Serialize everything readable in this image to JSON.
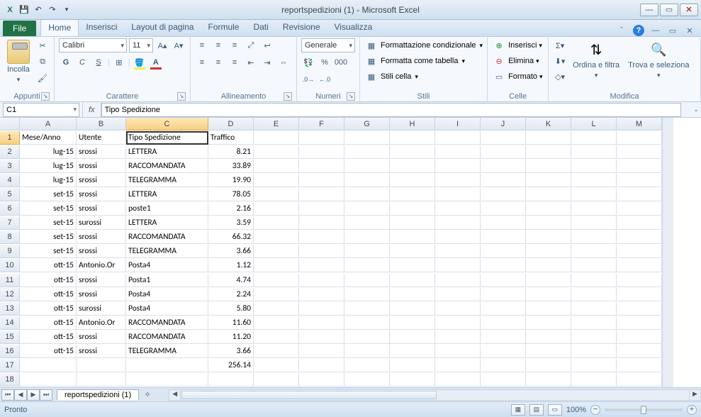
{
  "title": "reportspedizioni (1)  -  Microsoft Excel",
  "qat": {
    "save_tip": "Save",
    "undo_tip": "Undo",
    "redo_tip": "Redo"
  },
  "tabs": {
    "file": "File",
    "items": [
      "Home",
      "Inserisci",
      "Layout di pagina",
      "Formule",
      "Dati",
      "Revisione",
      "Visualizza"
    ],
    "active": 0
  },
  "ribbon": {
    "clipboard": {
      "paste": "Incolla",
      "group": "Appunti"
    },
    "font": {
      "group": "Carattere",
      "name": "Calibri",
      "size": "11",
      "bold": "G",
      "italic": "C",
      "underline": "S"
    },
    "align": {
      "group": "Allineamento"
    },
    "number": {
      "group": "Numeri",
      "format": "Generale"
    },
    "styles": {
      "group": "Stili",
      "cond": "Formattazione condizionale",
      "table": "Formatta come tabella",
      "cell": "Stili cella"
    },
    "cells": {
      "group": "Celle",
      "insert": "Inserisci",
      "delete": "Elimina",
      "format": "Formato"
    },
    "editing": {
      "group": "Modifica",
      "sort": "Ordina e filtra",
      "find": "Trova e seleziona"
    }
  },
  "formula": {
    "cellref": "C1",
    "value": "Tipo Spedizione"
  },
  "columns": [
    "A",
    "B",
    "C",
    "D",
    "E",
    "F",
    "G",
    "H",
    "I",
    "J",
    "K",
    "L",
    "M"
  ],
  "selected_col_index": 2,
  "selected_row": 1,
  "row_count": 18,
  "data_rows": [
    [
      "Mese/Anno",
      "Utente",
      "Tipo Spedizione",
      "Traffico"
    ],
    [
      "lug-15",
      "srossi",
      "LETTERA",
      "8.21"
    ],
    [
      "lug-15",
      "srossi",
      "RACCOMANDATA",
      "33.89"
    ],
    [
      "lug-15",
      "srossi",
      "TELEGRAMMA",
      "19.90"
    ],
    [
      "set-15",
      "srossi",
      "LETTERA",
      "78.05"
    ],
    [
      "set-15",
      "srossi",
      "poste1",
      "2.16"
    ],
    [
      "set-15",
      "surossi",
      "LETTERA",
      "3.59"
    ],
    [
      "set-15",
      "srossi",
      "RACCOMANDATA",
      "66.32"
    ],
    [
      "set-15",
      "srossi",
      "TELEGRAMMA",
      "3.66"
    ],
    [
      "ott-15",
      "Antonio.Or",
      "Posta4",
      "1.12"
    ],
    [
      "ott-15",
      "srossi",
      "Posta1",
      "4.74"
    ],
    [
      "ott-15",
      "srossi",
      "Posta4",
      "2.24"
    ],
    [
      "ott-15",
      "surossi",
      "Posta4",
      "5.80"
    ],
    [
      "ott-15",
      "Antonio.Or",
      "RACCOMANDATA",
      "11.60"
    ],
    [
      "ott-15",
      "srossi",
      "RACCOMANDATA",
      "11.20"
    ],
    [
      "ott-15",
      "srossi",
      "TELEGRAMMA",
      "3.66"
    ],
    [
      "",
      "",
      "",
      "256.14"
    ],
    [
      "",
      "",
      "",
      ""
    ]
  ],
  "right_align_cols": [
    0,
    3
  ],
  "sheet": {
    "name": "reportspedizioni (1)"
  },
  "status": {
    "ready": "Pronto",
    "zoom": "100%"
  }
}
